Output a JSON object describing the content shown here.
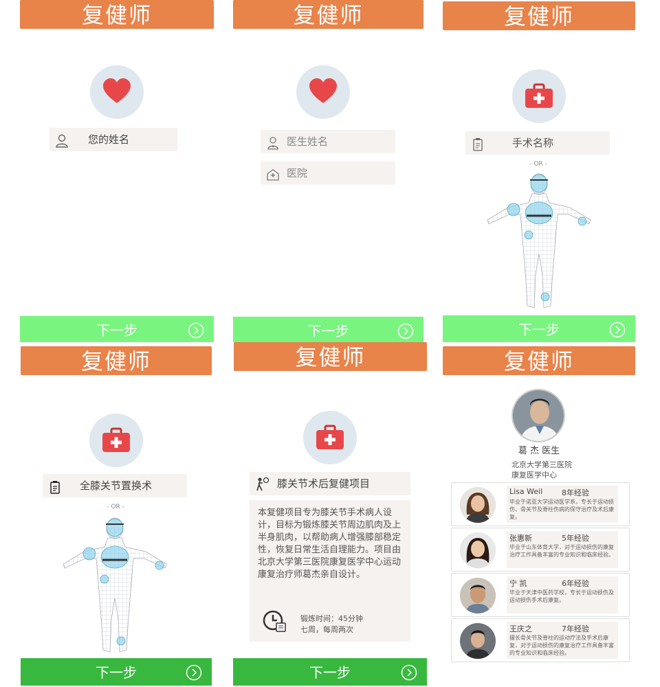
{
  "app_title": "复健师",
  "next_label": "下一步",
  "or_label": "- OR -",
  "screen1": {
    "name_placeholder": "您的姓名"
  },
  "screen2": {
    "doctor_placeholder": "医生姓名",
    "hospital_placeholder": "医院"
  },
  "screen3": {
    "surgery_placeholder": "手术名称"
  },
  "screen4": {
    "surgery_value": "全膝关节置换术"
  },
  "screen5": {
    "project_title": "膝关节术后复健项目",
    "description": "本复健项目专为膝关节手术病人设计，目标为锻炼膝关节周边肌肉及上半身肌肉，以帮助病人增强膝部稳定性，恢复日常生活自理能力。项目由北京大学第三医院康复医学中心运动康复治疗师葛杰亲自设计。",
    "exercise_time": "锻炼时间：45分钟",
    "schedule": "七周，每周两次"
  },
  "screen6": {
    "main_doctor": "葛 杰 医生",
    "hospital": "北京大学第三医院",
    "department": "康复医学中心",
    "therapists": [
      {
        "name": "Lisa Weil",
        "experience": "8年经验",
        "bio": "毕业于诺亚大学运动医学系，专长于运动损伤、骨关节及脊柱伤病的保守治疗及术后康复。"
      },
      {
        "name": "张惠新",
        "experience": "5年经验",
        "bio": "毕业于山东体育大学，对于运动损伤的康复治疗工作具备丰富的专业知识和临床经验。"
      },
      {
        "name": "宁 凯",
        "experience": "6年经验",
        "bio": "毕业于天津中医药学校，专长于运动损伤及运动损伤手术后康复。"
      },
      {
        "name": "王庆之",
        "experience": "7年经验",
        "bio": "擅长骨关节及脊柱的运动疗法及手术后康复，对于运动损伤的康复治疗工作具备丰富的专业知识和临床经验。"
      }
    ]
  },
  "colors": {
    "header": "#e8834a",
    "next_light": "#79f57f",
    "next_dark": "#39b83f",
    "field": "#f6f2ef",
    "icon_circle": "#dfe8ee"
  }
}
